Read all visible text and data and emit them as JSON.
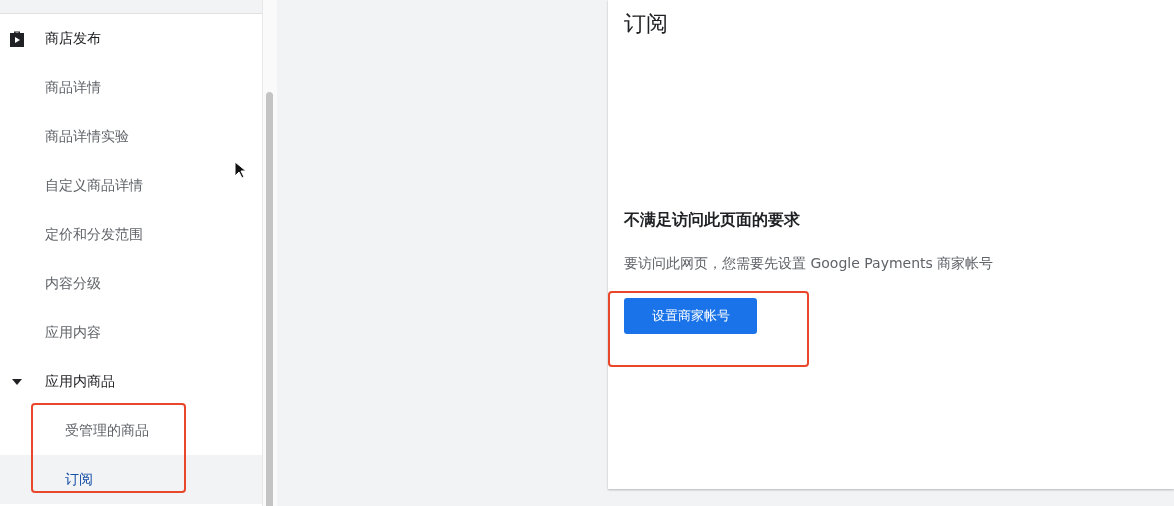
{
  "sidebar": {
    "items": [
      {
        "kind": "header",
        "label": "商店发布",
        "selected": false
      },
      {
        "kind": "item",
        "label": "商品详情",
        "selected": false
      },
      {
        "kind": "item",
        "label": "商品详情实验",
        "selected": false
      },
      {
        "kind": "item",
        "label": "自定义商品详情",
        "selected": false
      },
      {
        "kind": "item",
        "label": "定价和分发范围",
        "selected": false
      },
      {
        "kind": "item",
        "label": "内容分级",
        "selected": false
      },
      {
        "kind": "item",
        "label": "应用内容",
        "selected": false
      },
      {
        "kind": "group",
        "label": "应用内商品",
        "expanded": true,
        "selected": false,
        "children": [
          {
            "label": "受管理的商品",
            "selected": false
          },
          {
            "label": "订阅",
            "selected": true
          }
        ]
      }
    ]
  },
  "card": {
    "title": "订阅",
    "heading": "不满足访问此页面的要求",
    "message": "要访问此网页，您需要先设置 Google Payments 商家帐号",
    "button": "设置商家帐号"
  }
}
